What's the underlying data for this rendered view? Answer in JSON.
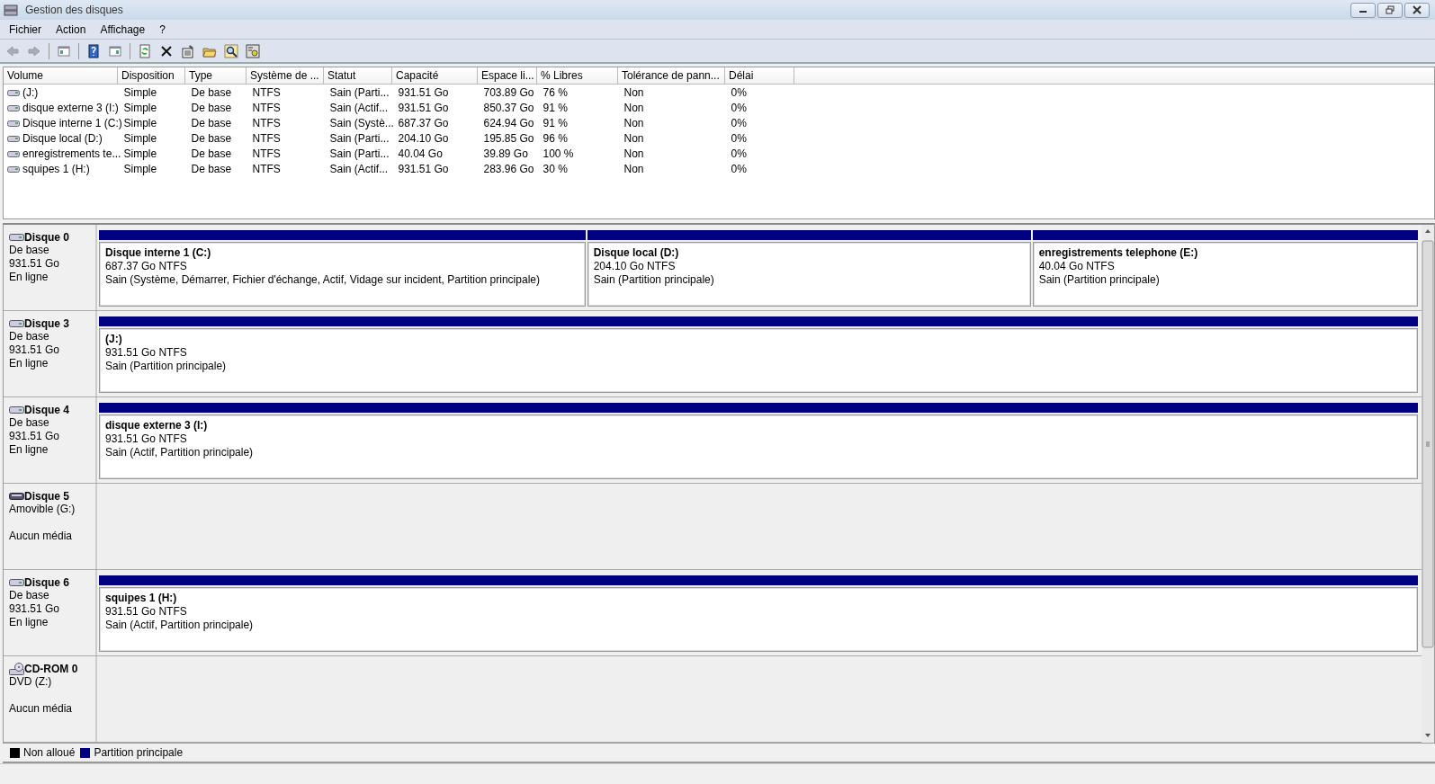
{
  "window": {
    "title": "Gestion des disques"
  },
  "menu": [
    "Fichier",
    "Action",
    "Affichage",
    "?"
  ],
  "toolbar": [
    {
      "kind": "back",
      "disabled": true
    },
    {
      "kind": "forward",
      "disabled": true
    },
    {
      "kind": "sep"
    },
    {
      "kind": "tree",
      "disabled": false
    },
    {
      "kind": "sep"
    },
    {
      "kind": "help",
      "disabled": false
    },
    {
      "kind": "pane",
      "disabled": false
    },
    {
      "kind": "sep"
    },
    {
      "kind": "refresh",
      "disabled": false
    },
    {
      "kind": "delete",
      "disabled": false
    },
    {
      "kind": "properties",
      "disabled": false
    },
    {
      "kind": "folder",
      "disabled": false
    },
    {
      "kind": "search",
      "disabled": false
    },
    {
      "kind": "settings",
      "disabled": false
    }
  ],
  "table": {
    "columns": [
      "Volume",
      "Disposition",
      "Type",
      "Système de ...",
      "Statut",
      "Capacité",
      "Espace li...",
      "% Libres",
      "Tolérance de pann...",
      "Délai"
    ],
    "rows": [
      [
        "(J:)",
        "Simple",
        "De base",
        "NTFS",
        "Sain (Parti...",
        "931.51 Go",
        "703.89 Go",
        "76 %",
        "Non",
        "0%"
      ],
      [
        "disque externe 3 (I:)",
        "Simple",
        "De base",
        "NTFS",
        "Sain (Actif...",
        "931.51 Go",
        "850.37 Go",
        "91 %",
        "Non",
        "0%"
      ],
      [
        "Disque interne 1 (C:)",
        "Simple",
        "De base",
        "NTFS",
        "Sain (Systè...",
        "687.37 Go",
        "624.94 Go",
        "91 %",
        "Non",
        "0%"
      ],
      [
        "Disque local (D:)",
        "Simple",
        "De base",
        "NTFS",
        "Sain (Parti...",
        "204.10 Go",
        "195.85 Go",
        "96 %",
        "Non",
        "0%"
      ],
      [
        "enregistrements te...",
        "Simple",
        "De base",
        "NTFS",
        "Sain (Parti...",
        "40.04 Go",
        "39.89 Go",
        "100 %",
        "Non",
        "0%"
      ],
      [
        "squipes 1 (H:)",
        "Simple",
        "De base",
        "NTFS",
        "Sain (Actif...",
        "931.51 Go",
        "283.96 Go",
        "30 %",
        "Non",
        "0%"
      ]
    ]
  },
  "disks": [
    {
      "kind": "hdd",
      "name": "Disque 0",
      "lines": [
        "De base",
        "931.51 Go",
        "En ligne"
      ],
      "partitions": [
        {
          "name": "Disque interne 1  (C:)",
          "size": "687.37 Go NTFS",
          "status": "Sain (Système, Démarrer, Fichier d'échange, Actif, Vidage sur incident, Partition principale)"
        },
        {
          "name": "Disque local  (D:)",
          "size": "204.10 Go NTFS",
          "status": "Sain (Partition principale)"
        },
        {
          "name": "enregistrements telephone  (E:)",
          "size": "40.04 Go NTFS",
          "status": "Sain (Partition principale)"
        }
      ]
    },
    {
      "kind": "hdd",
      "name": "Disque 3",
      "lines": [
        "De base",
        "931.51 Go",
        "En ligne"
      ],
      "partitions": [
        {
          "name": "(J:)",
          "size": "931.51 Go NTFS",
          "status": "Sain (Partition principale)"
        }
      ]
    },
    {
      "kind": "hdd",
      "name": "Disque 4",
      "lines": [
        "De base",
        "931.51 Go",
        "En ligne"
      ],
      "partitions": [
        {
          "name": "disque externe 3  (I:)",
          "size": "931.51 Go NTFS",
          "status": "Sain (Actif, Partition principale)"
        }
      ]
    },
    {
      "kind": "removable",
      "name": "Disque 5",
      "lines": [
        "Amovible (G:)",
        "Aucun média"
      ]
    },
    {
      "kind": "hdd",
      "name": "Disque 6",
      "lines": [
        "De base",
        "931.51 Go",
        "En ligne"
      ],
      "partitions": [
        {
          "name": "squipes 1  (H:)",
          "size": "931.51 Go NTFS",
          "status": "Sain (Actif, Partition principale)"
        }
      ]
    },
    {
      "kind": "cdrom",
      "name": "CD-ROM 0",
      "lines": [
        "DVD (Z:)",
        "Aucun média"
      ]
    }
  ],
  "legend": [
    {
      "label": "Non alloué",
      "color": "#000000"
    },
    {
      "label": "Partition principale",
      "color": "#000080"
    }
  ]
}
